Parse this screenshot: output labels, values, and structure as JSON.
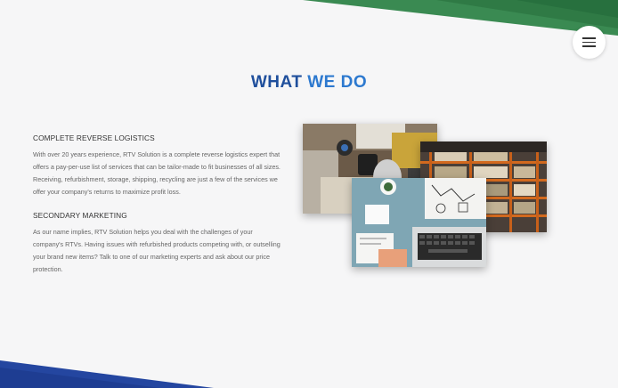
{
  "header": {
    "title_part1": "WHAT",
    "title_part2": "WE DO",
    "menu_icon": "hamburger-menu-icon"
  },
  "sections": [
    {
      "heading": "COMPLETE REVERSE LOGISTICS",
      "body": "With over 20 years experience, RTV Solution is a complete reverse logistics expert that offers a pay-per-use list of services that can be tailor-made to fit businesses of all sizes. Receiving, refurbishment, storage, shipping, recycling are just a few of the services we offer your company's returns to maximize profit loss."
    },
    {
      "heading": "SECONDARY MARKETING",
      "body": "As our name implies, RTV Solution helps you deal with the challenges of your company's RTVs. Having issues with refurbished products competing with, or outselling your brand new items? Talk to one of our marketing experts and ask about our price protection."
    }
  ],
  "colors": {
    "title_dark": "#1f4f9c",
    "title_light": "#2d79cf",
    "accent_green": "#2f7a45",
    "accent_blue": "#2446a0"
  }
}
